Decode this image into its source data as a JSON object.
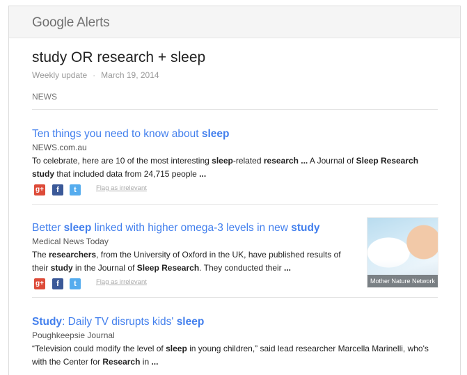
{
  "brand": {
    "google": "Google",
    "alerts": "Alerts"
  },
  "alert": {
    "query": "study OR research + sleep",
    "frequency": "Weekly update",
    "separator": "·",
    "date": "March 19, 2014",
    "section": "NEWS",
    "flag_label": "Flag as irrelevant"
  },
  "items": [
    {
      "title_html": "Ten things you need to know about <b>sleep</b>",
      "source": "NEWS.com.au",
      "snippet_html": "To celebrate, here are 10 of the most interesting <b>sleep</b>-related <b>research ...</b> A Journal of <b>Sleep Research study</b> that included data from 24,715 people <b>...</b>"
    },
    {
      "title_html": "Better <b>sleep</b> linked with higher omega-3 levels in new <b>study</b>",
      "source": "Medical News Today",
      "snippet_html": "The <b>researchers</b>, from the University of Oxford in the UK, have published results of their <b>study</b> in the Journal of <b>Sleep Research</b>. They conducted their <b>...</b>",
      "image_caption": "Mother Nature Network"
    },
    {
      "title_html": "<b>Study</b>: Daily TV disrupts kids' <b>sleep</b>",
      "source": "Poughkeepsie Journal",
      "snippet_html": "“Television could modify the level of <b>sleep</b> in young children,” said lead researcher Marcella Marinelli, who's with the Center for <b>Research</b> in <b>...</b>"
    }
  ],
  "icons": {
    "googleplus": "google-plus-icon",
    "facebook": "facebook-icon",
    "twitter": "twitter-icon"
  },
  "colors": {
    "link": "#427fed",
    "googleplus": "#dd4b39",
    "facebook": "#3b5998",
    "twitter": "#55acee"
  }
}
